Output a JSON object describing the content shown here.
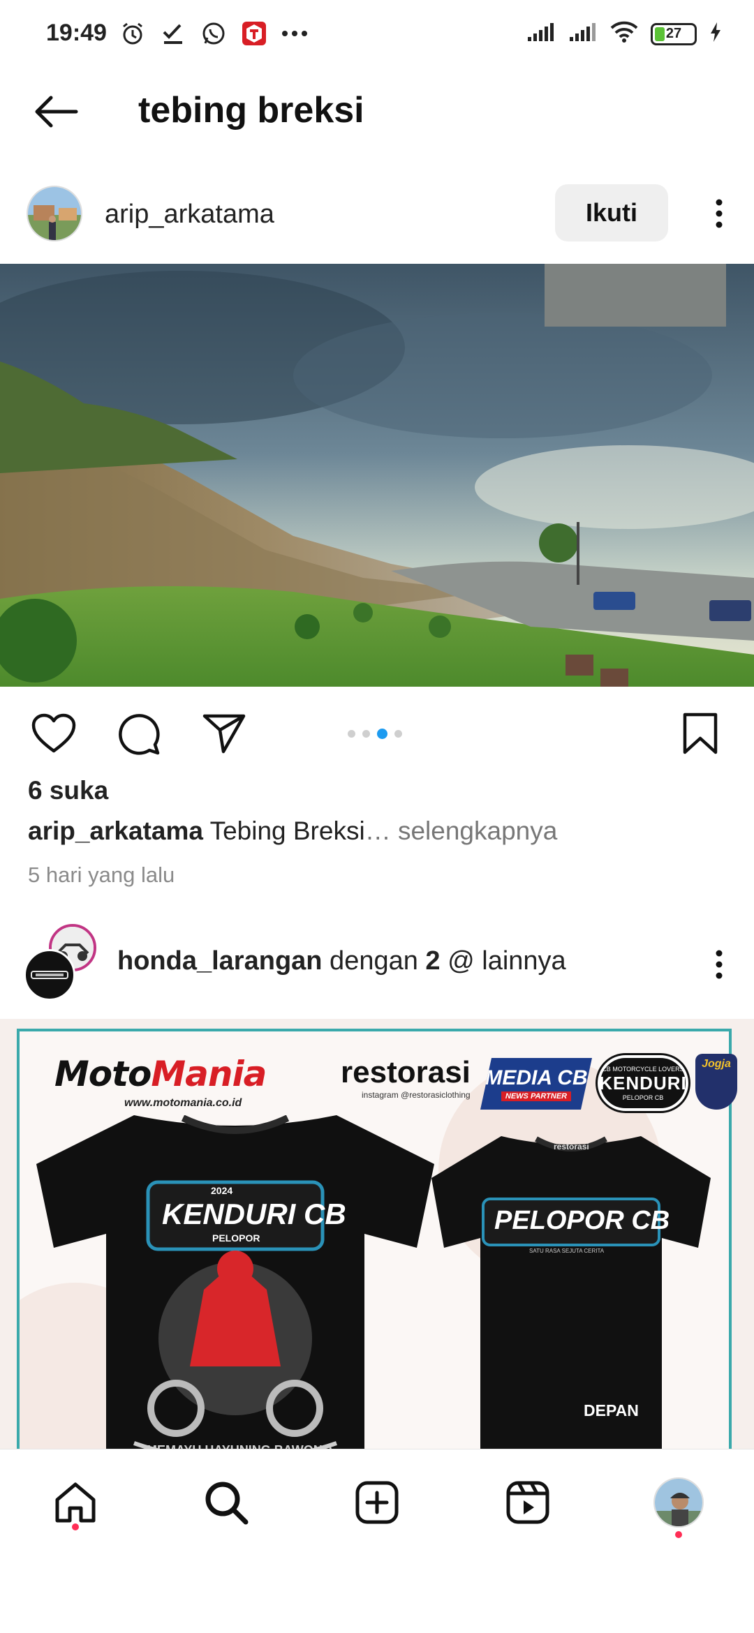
{
  "status_bar": {
    "time": "19:49",
    "battery": "27",
    "left_icons": [
      "alarm-icon",
      "check-icon",
      "whatsapp-icon",
      "app-t-icon",
      "more-dots-icon"
    ],
    "right_icons": [
      "signal-icon",
      "signal-icon",
      "wifi-icon",
      "battery-icon",
      "charging-icon"
    ]
  },
  "header": {
    "title": "tebing breksi",
    "back_icon": "arrow-left-icon"
  },
  "post1": {
    "username": "arip_arkatama",
    "follow_label": "Ikuti",
    "likes": "6 suka",
    "caption_user": "arip_arkatama",
    "caption_text": " Tebing Breksi",
    "caption_more": "… selengkapnya",
    "time_ago": "5 hari yang lalu",
    "carousel": {
      "count": 4,
      "active_index": 2
    }
  },
  "post2": {
    "username": "honda_larangan",
    "with_text": " dengan ",
    "count": "2",
    "rest_text": " @ lainnya",
    "banner": {
      "brand_moto_a": "Moto",
      "brand_moto_b": "Mania",
      "brand_url": "www.motomania.co.id",
      "brand_resto": "restorasi",
      "brand_resto_sub": "instagram @restorasiclothing",
      "media_title": "MEDIA CB",
      "media_sub": "NEWS PARTNER",
      "kenduri_top": "CB MOTORCYCLE LOVERS",
      "kenduri_title": "KENDURI",
      "kenduri_sub": "PELOPOR CB",
      "jogja": "Jogja",
      "shirt_back_year": "2024",
      "shirt_back_title": "KENDURI CB",
      "shirt_back_sub": "PELOPOR",
      "shirt_back_bottom": "MEMAYU HAYUNING BAWONO",
      "shirt_front_brand": "restorasi",
      "shirt_front_title": "PELOPOR CB",
      "shirt_front_sub": "SATU RASA SEJUTA CERITA",
      "shirt_front_label": "DEPAN"
    }
  },
  "bottom_nav": {
    "items": [
      "home-icon",
      "search-icon",
      "create-icon",
      "reels-icon",
      "profile-avatar"
    ]
  },
  "colors": {
    "accent_blue": "#1d9bf0",
    "notification_red": "#ff2d55",
    "follow_bg": "#efefef"
  }
}
